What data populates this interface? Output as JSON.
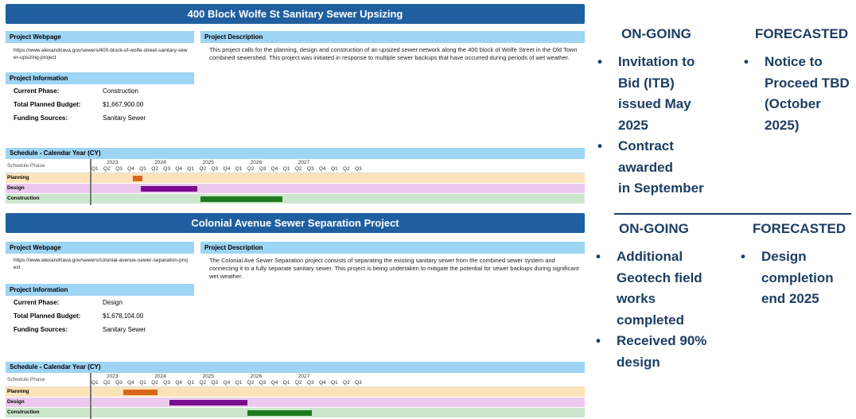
{
  "projects": [
    {
      "title": "400 Block Wolfe St Sanitary Sewer Upsizing",
      "webpage_label": "Project Webpage",
      "webpage_url": "https://www.alexandriava.gov/sewers/400-block-of-wolfe-street-sanitary-sewer-upsizing-project",
      "description_label": "Project Description",
      "description": "This project calls for the planning, design and construction of an upsized sewer network along the 400 block of Wolfe Street in the Old Town combined sewershed. This project was initiated in response to multiple sewer backups that have occurred during periods of wet weather.",
      "info_label": "Project Information",
      "info": [
        {
          "key": "Current Phase:",
          "value": "Construction"
        },
        {
          "key": "Total Planned Budget:",
          "value": "$1,667,900.00"
        },
        {
          "key": "Funding Sources:",
          "value": "Sanitary Sewer"
        }
      ],
      "schedule": {
        "label": "Schedule - Calendar Year (CY)",
        "phase_header": "Schedule Phase",
        "years": [
          "2023",
          "2024",
          "2025",
          "2026",
          "2027"
        ],
        "quarters": [
          "Q1",
          "Q2",
          "Q3",
          "Q4",
          "Q1",
          "Q2",
          "Q3",
          "Q4",
          "Q1",
          "Q2",
          "Q3",
          "Q4",
          "Q1",
          "Q2",
          "Q3",
          "Q4",
          "Q1",
          "Q2",
          "Q3",
          "Q4",
          "Q1",
          "Q2",
          "Q3"
        ],
        "phases": [
          {
            "name": "Planning",
            "start_q": 3.5,
            "end_q": 4.35,
            "row_color": "#fde3b9",
            "bar_color": "#d9651a"
          },
          {
            "name": "Design",
            "start_q": 4.2,
            "end_q": 8.9,
            "row_color": "#ecc9ee",
            "bar_color": "#7a0c8f"
          },
          {
            "name": "Construction",
            "start_q": 9.2,
            "end_q": 16.0,
            "row_color": "#cbe7cc",
            "bar_color": "#1f7a1f"
          }
        ]
      }
    },
    {
      "title": "Colonial Avenue Sewer Separation Project",
      "webpage_label": "Project Webpage",
      "webpage_url": "https://www.alexandriava.gov/sewers/colonial-avenue-sewer-separation-project",
      "description_label": "Project Description",
      "description": "The Colonial Ave Sewer Separation project consists of separating the existing sanitary sewer from the combined sewer system and connecting it to a fully separate sanitary sewer. This project is being undertaken to mitigate the potential for sewer backups during significant wet weather.",
      "info_label": "Project Information",
      "info": [
        {
          "key": "Current Phase:",
          "value": "Design"
        },
        {
          "key": "Total Planned Budget:",
          "value": "$1,678,104.00"
        },
        {
          "key": "Funding Sources:",
          "value": "Sanitary Sewer"
        }
      ],
      "schedule": {
        "label": "Schedule - Calendar Year (CY)",
        "phase_header": "Schedule Phase",
        "years": [
          "2023",
          "2024",
          "2025",
          "2026",
          "2027"
        ],
        "quarters": [
          "Q1",
          "Q2",
          "Q3",
          "Q4",
          "Q1",
          "Q2",
          "Q3",
          "Q4",
          "Q1",
          "Q2",
          "Q3",
          "Q4",
          "Q1",
          "Q2",
          "Q3",
          "Q4",
          "Q1",
          "Q2",
          "Q3",
          "Q4",
          "Q1",
          "Q2",
          "Q3"
        ],
        "phases": [
          {
            "name": "Planning",
            "start_q": 2.75,
            "end_q": 5.55,
            "row_color": "#fde3b9",
            "bar_color": "#d9651a"
          },
          {
            "name": "Design",
            "start_q": 6.6,
            "end_q": 13.1,
            "row_color": "#ecc9ee",
            "bar_color": "#7a0c8f"
          },
          {
            "name": "Construction",
            "start_q": 13.1,
            "end_q": 18.5,
            "row_color": "#cbe7cc",
            "bar_color": "#1f7a1f"
          }
        ]
      }
    }
  ],
  "status": [
    {
      "ongoing_label": "ON-GOING",
      "forecasted_label": "FORECASTED",
      "ongoing": [
        [
          "Invitation to",
          "Bid (ITB)",
          "issued May",
          "2025"
        ],
        [
          "Contract",
          "awarded",
          "in September"
        ]
      ],
      "forecasted": [
        [
          "Notice to",
          "Proceed TBD",
          "(October",
          "2025)"
        ]
      ]
    },
    {
      "ongoing_label": "ON-GOING",
      "forecasted_label": "FORECASTED",
      "ongoing": [
        [
          "Additional",
          "Geotech field",
          "works",
          "completed"
        ],
        [
          "Received 90%",
          "design"
        ]
      ],
      "forecasted": [
        [
          "Design",
          "completion",
          "end 2025"
        ]
      ]
    }
  ],
  "colors": {
    "title_bar": "#1f5fa0",
    "label_bg": "#9ed4f4",
    "status_text": "#1c3e63"
  },
  "bullet_glyph": "•"
}
